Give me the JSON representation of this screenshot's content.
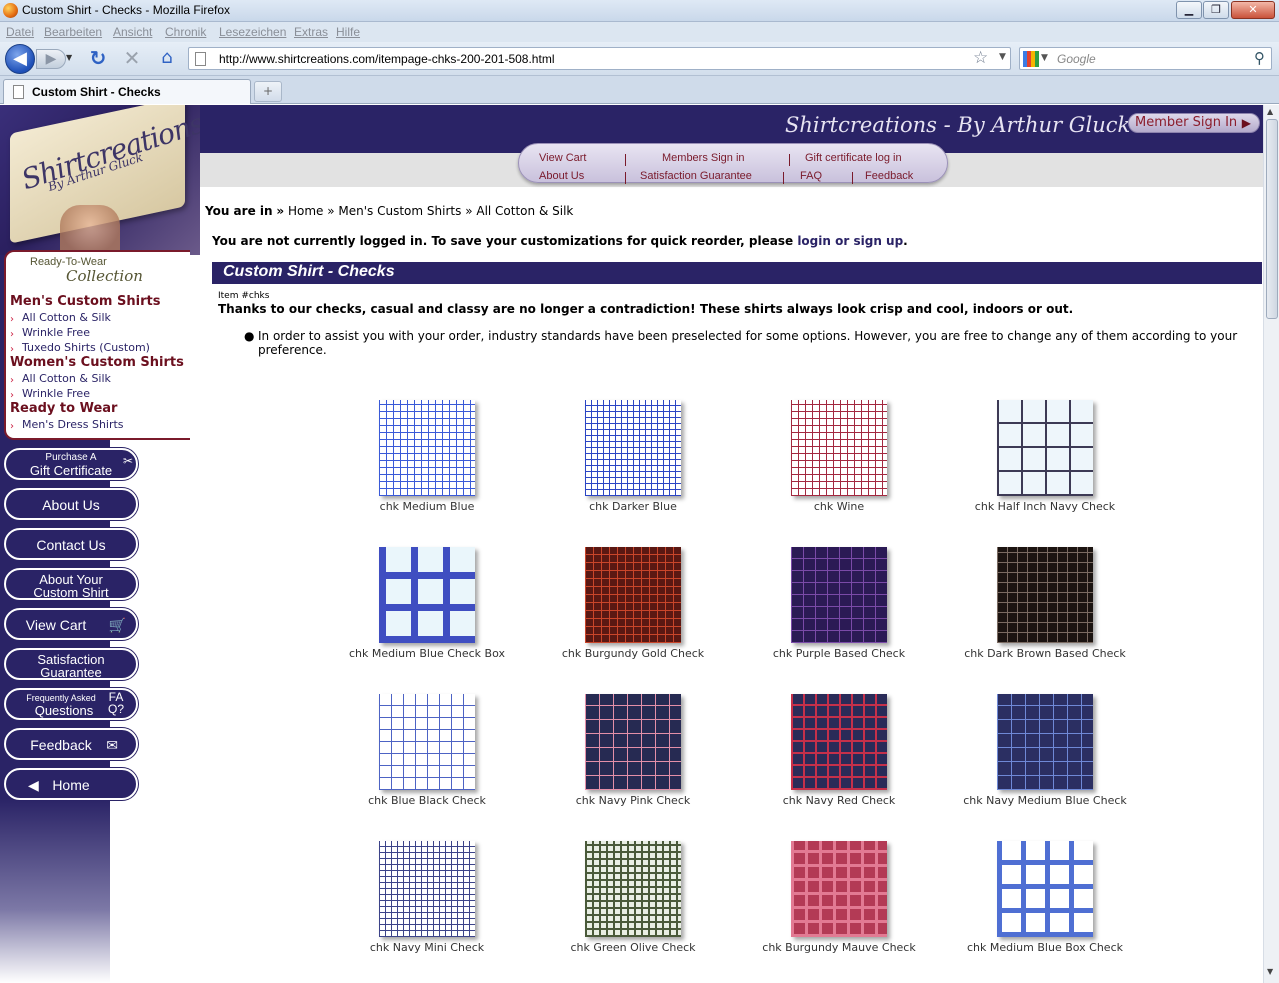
{
  "browser": {
    "window_title": "Custom Shirt - Checks - Mozilla Firefox",
    "menus": [
      "Datei",
      "Bearbeiten",
      "Ansicht",
      "Chronik",
      "Lesezeichen",
      "Extras",
      "Hilfe"
    ],
    "url": "http://www.shirtcreations.com/itempage-chks-200-201-508.html",
    "search_placeholder": "Google",
    "tab_title": "Custom Shirt - Checks",
    "newtab_label": "+"
  },
  "site": {
    "logo_text": "Shirtcreations",
    "logo_sub": "By Arthur Gluck",
    "title": "Shirtcreations - By Arthur Gluck",
    "member_signin": "Member Sign In"
  },
  "topnav": [
    "View Cart",
    "Members Sign in",
    "Gift certificate log in",
    "About Us",
    "Satisfaction Guarantee",
    "FAQ",
    "Feedback"
  ],
  "sidebar": {
    "rtw_title": "Ready-To-Wear",
    "rtw_collection": "Collection",
    "cat1": "Men's Custom Shirts",
    "cat1_links": [
      "All Cotton & Silk",
      "Wrinkle Free",
      "Tuxedo Shirts (Custom)"
    ],
    "cat2": "Women's Custom Shirts",
    "cat2_links": [
      "All Cotton & Silk",
      "Wrinkle Free"
    ],
    "cat3": "Ready to Wear",
    "cat3_links": [
      "Men's Dress Shirts"
    ],
    "pills": {
      "gift_l1": "Purchase A",
      "gift_l2": "Gift Certificate",
      "about": "About Us",
      "contact": "Contact Us",
      "about_shirt_l1": "About Your",
      "about_shirt_l2": "Custom Shirt",
      "view_cart": "View Cart",
      "satisfaction_l1": "Satisfaction",
      "satisfaction_l2": "Guarantee",
      "faq_l1": "Frequently Asked",
      "faq_l2": "Questions",
      "faq_icon": "FA Q?",
      "feedback": "Feedback",
      "home": "Home"
    }
  },
  "breadcrumb": {
    "lead": "You are in",
    "sep": "»",
    "items": [
      "Home",
      "Men's Custom Shirts",
      "All Cotton & Silk"
    ]
  },
  "notice": {
    "text": "You are not currently logged in. To save your customizations for quick reorder, please",
    "login": "login",
    "or": "or",
    "signup": "sign up",
    "end": "."
  },
  "page": {
    "title": "Custom Shirt - Checks",
    "item_no": "Item #chks",
    "intro": "Thanks to our checks, casual and classy are no longer a contradiction! These shirts always look crisp and cool, indoors or out.",
    "note": "In order to assist you with your order, industry standards have been preselected for some options. However, you are free to change any of them according to your preference."
  },
  "swatches": [
    {
      "label": "chk Medium Blue",
      "bg": "#ffffff",
      "line": "#3a5ad8",
      "step": 7,
      "w": 1
    },
    {
      "label": "chk Darker Blue",
      "bg": "#ffffff",
      "line": "#2b45c4",
      "step": 6,
      "w": 1
    },
    {
      "label": "chk Wine",
      "bg": "#ffffff",
      "line": "#a3283f",
      "step": 7,
      "w": 1
    },
    {
      "label": "chk Half Inch Navy Check",
      "bg": "#eef6fb",
      "line": "#3d3a55",
      "step": 24,
      "w": 2
    },
    {
      "label": "chk Medium Blue Check Box",
      "bg": "#eaf6fb",
      "line": "#3f4ec1",
      "step": 32,
      "w": 7
    },
    {
      "label": "chk Burgundy Gold Check",
      "bg": "#5a1813",
      "line": "#c9452a",
      "step": 8,
      "w": 1
    },
    {
      "label": "chk Purple Based Check",
      "bg": "#2b1a55",
      "line": "#7a4aa8",
      "step": 12,
      "w": 1
    },
    {
      "label": "chk Dark Brown Based Check",
      "bg": "#1c1411",
      "line": "#7b6b62",
      "step": 10,
      "w": 1
    },
    {
      "label": "chk Blue Black Check",
      "bg": "#ffffff",
      "line": "#4d63c4",
      "step": 12,
      "w": 1
    },
    {
      "label": "chk Navy Pink Check",
      "bg": "#262a52",
      "line": "#e38fa8",
      "step": 14,
      "w": 1
    },
    {
      "label": "chk Navy Red Check",
      "bg": "#2a2b58",
      "line": "#c5304a",
      "step": 12,
      "w": 2
    },
    {
      "label": "chk Navy Medium Blue Check",
      "bg": "#2b2f62",
      "line": "#6f89d6",
      "step": 14,
      "w": 1
    },
    {
      "label": "chk Navy Mini Check",
      "bg": "#ffffff",
      "line": "#3c4389",
      "step": 6,
      "w": 1
    },
    {
      "label": "chk Green Olive Check",
      "bg": "#e9efe4",
      "line": "#4a5a3a",
      "step": 7,
      "w": 2
    },
    {
      "label": "chk Burgundy Mauve Check",
      "bg": "#b33a55",
      "line": "#e27a93",
      "step": 14,
      "w": 3
    },
    {
      "label": "chk Medium Blue Box Check",
      "bg": "#ffffff",
      "line": "#4f6fd3",
      "step": 24,
      "w": 5
    }
  ]
}
